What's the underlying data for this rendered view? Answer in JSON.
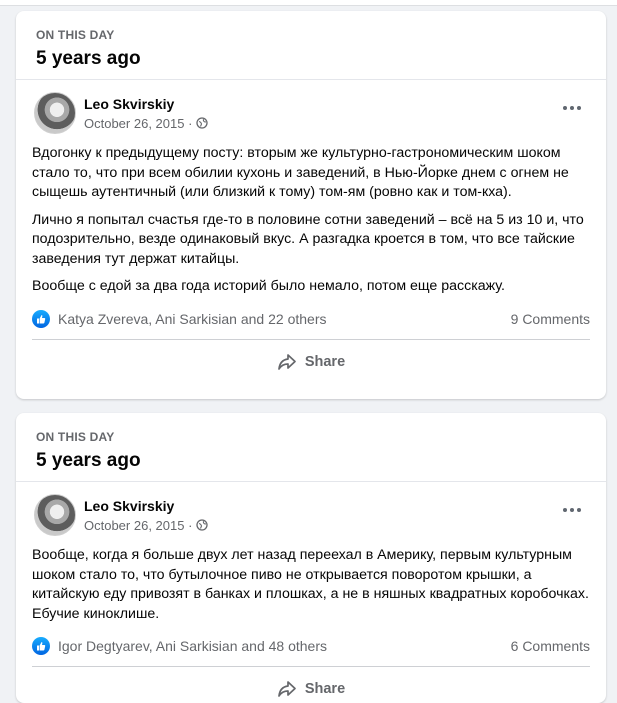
{
  "colors": {
    "background": "#f0f2f5",
    "card": "#ffffff",
    "secondary_text": "#65676b",
    "like_blue": "#0866ff"
  },
  "icons": {
    "visibility": "globe-icon",
    "more": "more-options-icon",
    "reaction": "like-icon",
    "share": "share-arrow-icon"
  },
  "memories": [
    {
      "label": "ON THIS DAY",
      "years_ago": "5 years ago",
      "post": {
        "author": "Leo Skvirskiy",
        "date": "October 26, 2015 ·",
        "paragraphs": [
          "Вдогонку к предыдущему посту: вторым же культурно-гастрономическим шоком стало то, что при всем обилии кухонь и заведений, в Нью-Йорке днем с огнем не сыщешь аутентичный (или близкий к тому) том-ям (ровно как и том-кха).",
          "Лично я попытал счастья где-то в половине сотни заведений – всё на 5 из 10 и, что подозрительно, везде одинаковый вкус. А разгадка кроется в том, что все тайские заведения тут держат китайцы.",
          "Вообще с едой за два года историй было немало, потом еще расскажу."
        ],
        "reactions": "Katya Zvereva, Ani Sarkisian and 22 others",
        "comments": "9 Comments",
        "share_label": "Share"
      }
    },
    {
      "label": "ON THIS DAY",
      "years_ago": "5 years ago",
      "post": {
        "author": "Leo Skvirskiy",
        "date": "October 26, 2015 ·",
        "paragraphs": [
          "Вообще, когда я больше двух лет назад переехал в Америку, первым культурным шоком стало то, что бутылочное пиво не открывается поворотом крышки, а китайскую еду привозят в банках и плошках, а не в няшных квадратных коробочках. Ебучие киноклише."
        ],
        "reactions": "Igor Degtyarev, Ani Sarkisian and 48 others",
        "comments": "6 Comments",
        "share_label": "Share"
      }
    }
  ]
}
